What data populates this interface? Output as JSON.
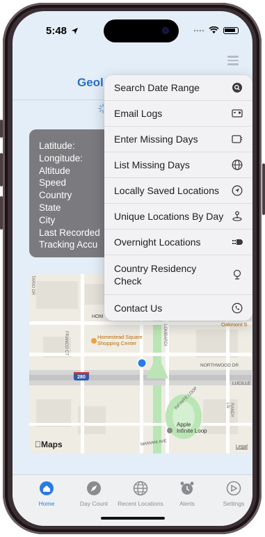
{
  "status": {
    "time": "5:48"
  },
  "header": {
    "title": "Geol"
  },
  "info": {
    "lines": [
      "Latitude:",
      "Longitude:",
      "Altitude",
      "Speed",
      "Country",
      "State",
      "City",
      "Last Recorded",
      "Tracking Accu"
    ]
  },
  "menu": {
    "items": [
      {
        "label": "Search Date Range",
        "icon": "search-icon"
      },
      {
        "label": "Email Logs",
        "icon": "email-icon"
      },
      {
        "label": "Enter Missing Days",
        "icon": "calendar-icon"
      },
      {
        "label": "List Missing Days",
        "icon": "globe-icon"
      },
      {
        "label": "Locally Saved Locations",
        "icon": "location-icon"
      },
      {
        "label": "Unique Locations By Day",
        "icon": "pin-icon"
      },
      {
        "label": "Overnight Locations",
        "icon": "bed-icon"
      },
      {
        "label": "Country Residency Check",
        "icon": "microphone-icon"
      },
      {
        "label": "Contact Us",
        "icon": "phone-icon"
      }
    ]
  },
  "map": {
    "labels": {
      "street_hom": "HOM",
      "homestead_square_line1": "Homestead Square",
      "homestead_square_line2": "Shopping Center",
      "oakmont": "Oakmont S",
      "northwood": "NORTHWOOD DR",
      "lucille": "LUCILLE",
      "francoct": "FRANCO CT",
      "lombardi": "LOMBARDI",
      "infinite_loop": "INFINITE LOOP",
      "apple_line1": "Apple",
      "apple_line2": "Infinite Loop",
      "mariani": "MARIANI AVE",
      "randy": "RANDY LN",
      "tario": "TARIO DR",
      "interstate": "280"
    },
    "brand": "Maps",
    "legal": "Legal"
  },
  "tabs": [
    {
      "label": "Home",
      "icon": "home-icon",
      "active": true
    },
    {
      "label": "Day Count",
      "icon": "compass-icon",
      "active": false
    },
    {
      "label": "Recent Locations",
      "icon": "globe-icon",
      "active": false
    },
    {
      "label": "Alerts",
      "icon": "alarm-icon",
      "active": false
    },
    {
      "label": "Settings",
      "icon": "settings-icon",
      "active": false
    }
  ],
  "colors": {
    "accent": "#2b7ae0",
    "title": "#2c6fc8",
    "card": "#7b7b7f"
  }
}
